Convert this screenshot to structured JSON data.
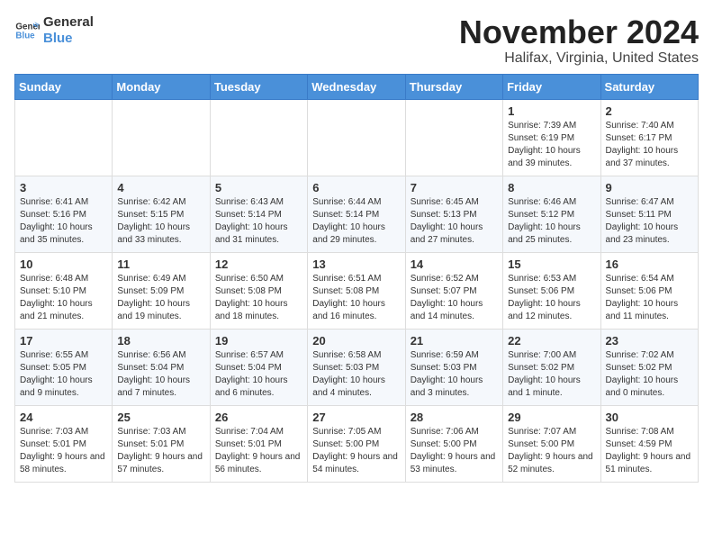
{
  "logo": {
    "general": "General",
    "blue": "Blue"
  },
  "header": {
    "month": "November 2024",
    "location": "Halifax, Virginia, United States"
  },
  "weekdays": [
    "Sunday",
    "Monday",
    "Tuesday",
    "Wednesday",
    "Thursday",
    "Friday",
    "Saturday"
  ],
  "weeks": [
    [
      {
        "day": "",
        "info": ""
      },
      {
        "day": "",
        "info": ""
      },
      {
        "day": "",
        "info": ""
      },
      {
        "day": "",
        "info": ""
      },
      {
        "day": "",
        "info": ""
      },
      {
        "day": "1",
        "info": "Sunrise: 7:39 AM\nSunset: 6:19 PM\nDaylight: 10 hours and 39 minutes."
      },
      {
        "day": "2",
        "info": "Sunrise: 7:40 AM\nSunset: 6:17 PM\nDaylight: 10 hours and 37 minutes."
      }
    ],
    [
      {
        "day": "3",
        "info": "Sunrise: 6:41 AM\nSunset: 5:16 PM\nDaylight: 10 hours and 35 minutes."
      },
      {
        "day": "4",
        "info": "Sunrise: 6:42 AM\nSunset: 5:15 PM\nDaylight: 10 hours and 33 minutes."
      },
      {
        "day": "5",
        "info": "Sunrise: 6:43 AM\nSunset: 5:14 PM\nDaylight: 10 hours and 31 minutes."
      },
      {
        "day": "6",
        "info": "Sunrise: 6:44 AM\nSunset: 5:14 PM\nDaylight: 10 hours and 29 minutes."
      },
      {
        "day": "7",
        "info": "Sunrise: 6:45 AM\nSunset: 5:13 PM\nDaylight: 10 hours and 27 minutes."
      },
      {
        "day": "8",
        "info": "Sunrise: 6:46 AM\nSunset: 5:12 PM\nDaylight: 10 hours and 25 minutes."
      },
      {
        "day": "9",
        "info": "Sunrise: 6:47 AM\nSunset: 5:11 PM\nDaylight: 10 hours and 23 minutes."
      }
    ],
    [
      {
        "day": "10",
        "info": "Sunrise: 6:48 AM\nSunset: 5:10 PM\nDaylight: 10 hours and 21 minutes."
      },
      {
        "day": "11",
        "info": "Sunrise: 6:49 AM\nSunset: 5:09 PM\nDaylight: 10 hours and 19 minutes."
      },
      {
        "day": "12",
        "info": "Sunrise: 6:50 AM\nSunset: 5:08 PM\nDaylight: 10 hours and 18 minutes."
      },
      {
        "day": "13",
        "info": "Sunrise: 6:51 AM\nSunset: 5:08 PM\nDaylight: 10 hours and 16 minutes."
      },
      {
        "day": "14",
        "info": "Sunrise: 6:52 AM\nSunset: 5:07 PM\nDaylight: 10 hours and 14 minutes."
      },
      {
        "day": "15",
        "info": "Sunrise: 6:53 AM\nSunset: 5:06 PM\nDaylight: 10 hours and 12 minutes."
      },
      {
        "day": "16",
        "info": "Sunrise: 6:54 AM\nSunset: 5:06 PM\nDaylight: 10 hours and 11 minutes."
      }
    ],
    [
      {
        "day": "17",
        "info": "Sunrise: 6:55 AM\nSunset: 5:05 PM\nDaylight: 10 hours and 9 minutes."
      },
      {
        "day": "18",
        "info": "Sunrise: 6:56 AM\nSunset: 5:04 PM\nDaylight: 10 hours and 7 minutes."
      },
      {
        "day": "19",
        "info": "Sunrise: 6:57 AM\nSunset: 5:04 PM\nDaylight: 10 hours and 6 minutes."
      },
      {
        "day": "20",
        "info": "Sunrise: 6:58 AM\nSunset: 5:03 PM\nDaylight: 10 hours and 4 minutes."
      },
      {
        "day": "21",
        "info": "Sunrise: 6:59 AM\nSunset: 5:03 PM\nDaylight: 10 hours and 3 minutes."
      },
      {
        "day": "22",
        "info": "Sunrise: 7:00 AM\nSunset: 5:02 PM\nDaylight: 10 hours and 1 minute."
      },
      {
        "day": "23",
        "info": "Sunrise: 7:02 AM\nSunset: 5:02 PM\nDaylight: 10 hours and 0 minutes."
      }
    ],
    [
      {
        "day": "24",
        "info": "Sunrise: 7:03 AM\nSunset: 5:01 PM\nDaylight: 9 hours and 58 minutes."
      },
      {
        "day": "25",
        "info": "Sunrise: 7:03 AM\nSunset: 5:01 PM\nDaylight: 9 hours and 57 minutes."
      },
      {
        "day": "26",
        "info": "Sunrise: 7:04 AM\nSunset: 5:01 PM\nDaylight: 9 hours and 56 minutes."
      },
      {
        "day": "27",
        "info": "Sunrise: 7:05 AM\nSunset: 5:00 PM\nDaylight: 9 hours and 54 minutes."
      },
      {
        "day": "28",
        "info": "Sunrise: 7:06 AM\nSunset: 5:00 PM\nDaylight: 9 hours and 53 minutes."
      },
      {
        "day": "29",
        "info": "Sunrise: 7:07 AM\nSunset: 5:00 PM\nDaylight: 9 hours and 52 minutes."
      },
      {
        "day": "30",
        "info": "Sunrise: 7:08 AM\nSunset: 4:59 PM\nDaylight: 9 hours and 51 minutes."
      }
    ]
  ]
}
